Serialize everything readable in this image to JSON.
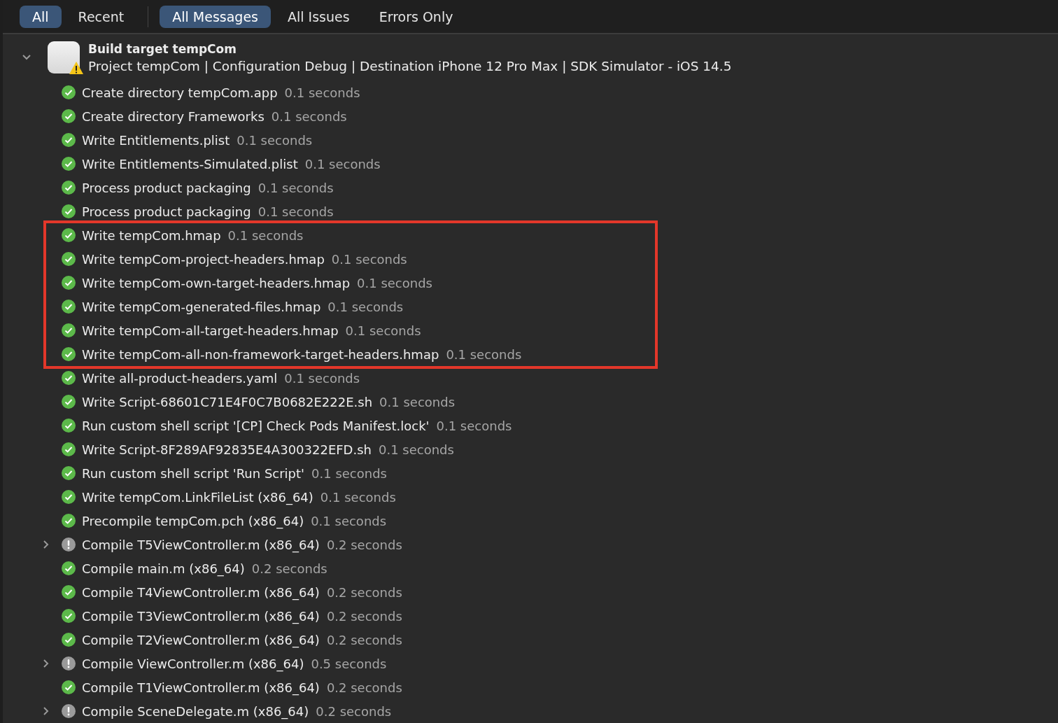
{
  "scope_tabs": [
    {
      "label": "All",
      "selected": true
    },
    {
      "label": "Recent",
      "selected": false
    }
  ],
  "filter_tabs": [
    {
      "label": "All Messages",
      "selected": true
    },
    {
      "label": "All Issues",
      "selected": false
    },
    {
      "label": "Errors Only",
      "selected": false
    }
  ],
  "target": {
    "title": "Build target tempCom",
    "details": "Project tempCom | Configuration Debug | Destination iPhone 12 Pro Max | SDK Simulator - iOS 14.5",
    "expanded": true,
    "warning": true
  },
  "steps": [
    {
      "kind": "step",
      "label": "Create directory tempCom.app",
      "time": "0.1 seconds",
      "succeeded": true,
      "collapsible": false
    },
    {
      "kind": "step",
      "label": "Create directory Frameworks",
      "time": "0.1 seconds",
      "succeeded": true,
      "collapsible": false
    },
    {
      "kind": "step",
      "label": "Write Entitlements.plist",
      "time": "0.1 seconds",
      "succeeded": true,
      "collapsible": false
    },
    {
      "kind": "step",
      "label": "Write Entitlements-Simulated.plist",
      "time": "0.1 seconds",
      "succeeded": true,
      "collapsible": false
    },
    {
      "kind": "step",
      "label": "Process product packaging",
      "time": "0.1 seconds",
      "succeeded": true,
      "collapsible": false
    },
    {
      "kind": "step",
      "label": "Process product packaging",
      "time": "0.1 seconds",
      "succeeded": true,
      "collapsible": false
    },
    {
      "kind": "highlight",
      "steps": [
        {
          "kind": "step",
          "label": "Write tempCom.hmap",
          "time": "0.1 seconds",
          "succeeded": true,
          "collapsible": false
        },
        {
          "kind": "step",
          "label": "Write tempCom-project-headers.hmap",
          "time": "0.1 seconds",
          "succeeded": true,
          "collapsible": false
        },
        {
          "kind": "step",
          "label": "Write tempCom-own-target-headers.hmap",
          "time": "0.1 seconds",
          "succeeded": true,
          "collapsible": false
        },
        {
          "kind": "step",
          "label": "Write tempCom-generated-files.hmap",
          "time": "0.1 seconds",
          "succeeded": true,
          "collapsible": false
        },
        {
          "kind": "step",
          "label": "Write tempCom-all-target-headers.hmap",
          "time": "0.1 seconds",
          "succeeded": true,
          "collapsible": false
        },
        {
          "kind": "step",
          "label": "Write tempCom-all-non-framework-target-headers.hmap",
          "time": "0.1 seconds",
          "succeeded": true,
          "collapsible": false
        }
      ]
    },
    {
      "kind": "step",
      "label": "Write all-product-headers.yaml",
      "time": "0.1 seconds",
      "succeeded": true,
      "collapsible": false
    },
    {
      "kind": "step",
      "label": "Write Script-68601C71E4F0C7B0682E222E.sh",
      "time": "0.1 seconds",
      "succeeded": true,
      "collapsible": false
    },
    {
      "kind": "step",
      "label": "Run custom shell script '[CP] Check Pods Manifest.lock'",
      "time": "0.1 seconds",
      "succeeded": true,
      "collapsible": false
    },
    {
      "kind": "step",
      "label": "Write Script-8F289AF92835E4A300322EFD.sh",
      "time": "0.1 seconds",
      "succeeded": true,
      "collapsible": false
    },
    {
      "kind": "step",
      "label": "Run custom shell script 'Run Script'",
      "time": "0.1 seconds",
      "succeeded": true,
      "collapsible": false
    },
    {
      "kind": "step",
      "label": "Write tempCom.LinkFileList (x86_64)",
      "time": "0.1 seconds",
      "succeeded": true,
      "collapsible": false
    },
    {
      "kind": "step",
      "label": "Precompile tempCom.pch (x86_64)",
      "time": "0.1 seconds",
      "succeeded": true,
      "collapsible": false
    },
    {
      "kind": "step",
      "label": "Compile T5ViewController.m (x86_64)",
      "time": "0.2 seconds",
      "succeeded": false,
      "collapsible": true
    },
    {
      "kind": "step",
      "label": "Compile main.m (x86_64)",
      "time": "0.2 seconds",
      "succeeded": true,
      "collapsible": false
    },
    {
      "kind": "step",
      "label": "Compile T4ViewController.m (x86_64)",
      "time": "0.2 seconds",
      "succeeded": true,
      "collapsible": false
    },
    {
      "kind": "step",
      "label": "Compile T3ViewController.m (x86_64)",
      "time": "0.2 seconds",
      "succeeded": true,
      "collapsible": false
    },
    {
      "kind": "step",
      "label": "Compile T2ViewController.m (x86_64)",
      "time": "0.2 seconds",
      "succeeded": true,
      "collapsible": false
    },
    {
      "kind": "step",
      "label": "Compile ViewController.m (x86_64)",
      "time": "0.5 seconds",
      "succeeded": false,
      "collapsible": true
    },
    {
      "kind": "step",
      "label": "Compile T1ViewController.m (x86_64)",
      "time": "0.2 seconds",
      "succeeded": true,
      "collapsible": false
    },
    {
      "kind": "step",
      "label": "Compile SceneDelegate.m (x86_64)",
      "time": "0.2 seconds",
      "succeeded": false,
      "collapsible": true
    }
  ]
}
